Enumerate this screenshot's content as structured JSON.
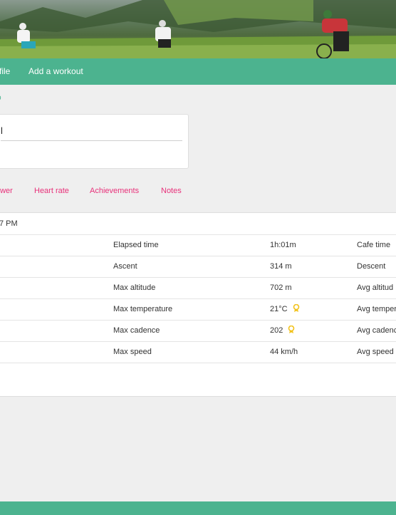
{
  "colors": {
    "accent": "#4cb38f",
    "tab_link": "#e8317a",
    "award": "#f2c21b"
  },
  "nav": {
    "items": [
      "file",
      "Add a workout"
    ]
  },
  "breadcrumb": {
    "text": "b"
  },
  "card": {
    "title": "l"
  },
  "tabs": [
    "ower",
    "Heart rate",
    "Achievements",
    "Notes"
  ],
  "table": {
    "header": "7 PM",
    "rows": [
      {
        "label": "Elapsed time",
        "value": "1h:01m",
        "extra": "Cafe time",
        "award": false
      },
      {
        "label": "Ascent",
        "value": "314 m",
        "extra": "Descent",
        "award": false
      },
      {
        "label": "Max altitude",
        "value": "702 m",
        "extra": "Avg altitud",
        "award": false
      },
      {
        "label": "Max temperature",
        "value": "21°C",
        "extra": "Avg temper",
        "award": true
      },
      {
        "label": "Max cadence",
        "value": "202",
        "extra": "Avg cadenc",
        "award": true
      },
      {
        "label": "Max speed",
        "value": "44 km/h",
        "extra": "Avg speed",
        "award": false
      }
    ]
  }
}
